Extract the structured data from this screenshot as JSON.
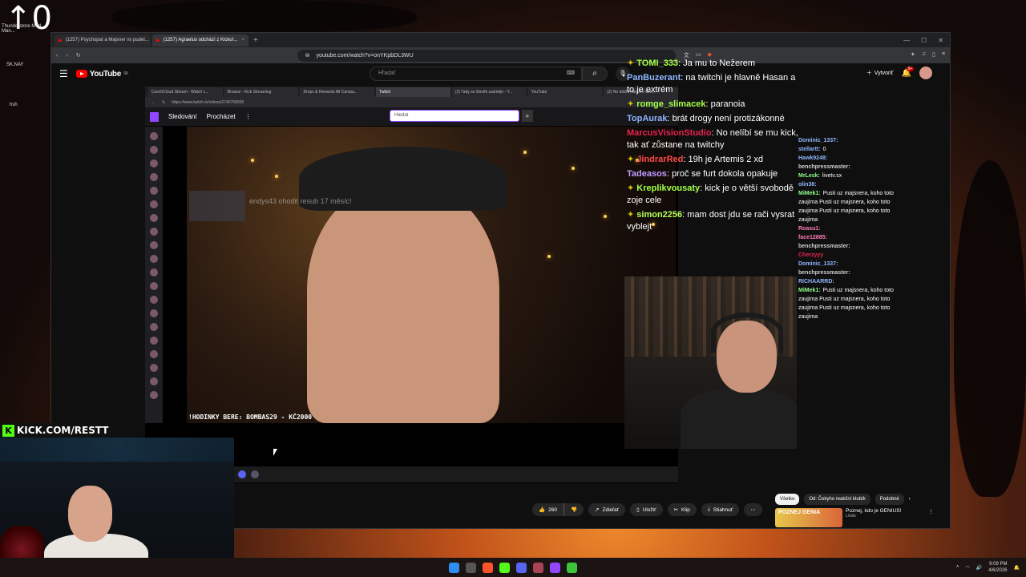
{
  "desktop": {
    "top_digit": "0",
    "labels": [
      "Thunderstore Mod Man...",
      "SK.NAY",
      "hsh"
    ]
  },
  "browser": {
    "tabs": [
      {
        "label": "(1257) Psychopat a Majsner vs pudel...",
        "active": false
      },
      {
        "label": "(1257) Agraelus odchází z Kicku!...",
        "active": true
      }
    ],
    "url": "youtube.com/watch?v=onYKpbDL3WU"
  },
  "youtube": {
    "logo_text": "YouTube",
    "region": "SK",
    "search_placeholder": "Hľadať",
    "create_label": "Vytvoriť",
    "notif_count": "9+"
  },
  "inner_browser": {
    "tabs": [
      "CzechCloud Stream - Watch L...",
      "Browse - Kick Streaming",
      "Drops & Rewards All Campa...",
      "Twitch",
      "(2) Tady se člověk zasměje - Y...",
      "YouTube",
      "(2) No dobře, tak si o tom..."
    ],
    "active_tab": 3,
    "url": "https://www.twitch.tv/videos/2740758965"
  },
  "twitch": {
    "nav_following": "Sledování",
    "nav_browse": "Procházet",
    "search_placeholder": "Hledat",
    "resub_text": "endys43 ohodit resub 17 měsíc!",
    "overlay_text": "!HODINKY BERE: BOMBAS29 - KČ2000"
  },
  "main_chat": [
    {
      "user": "TOMI_333",
      "color": "#a4ff46",
      "text": "Ja mu to Nežerem",
      "badge": true
    },
    {
      "user": "PanBuzerant",
      "color": "#8fb6ff",
      "text": "na twitchi je hlavně Hasan a to je extrém",
      "badge": false
    },
    {
      "user": "romge_slimacek",
      "color": "#a4ff46",
      "text": "paranoia",
      "badge": true
    },
    {
      "user": "TopAurak",
      "color": "#8fb6ff",
      "text": "brát drogy není protizákonné",
      "badge": false
    },
    {
      "user": "MarcusVisionStudio",
      "color": "#e8234f",
      "text": "No nelíbí se mu kick, tak ať zůstane na twitchy",
      "badge": false
    },
    {
      "user": "JindrarRed",
      "color": "#ff4a4a",
      "text": "19h je Artemis 2 xd",
      "badge": true
    },
    {
      "user": "Tadeasos",
      "color": "#c49bff",
      "text": "proč se furt dokola opakuje",
      "badge": false
    },
    {
      "user": "Kreplikvousaty",
      "color": "#a4ff46",
      "text": "kick je o větší svobodě zoje cele",
      "badge": true
    },
    {
      "user": "simon2256",
      "color": "#b8ff5a",
      "text": "mam dost jdu se rači vysrat vyblejt",
      "badge": true
    }
  ],
  "side_chat": [
    {
      "user": "Dominic_1337:",
      "color": "#8fb6ff",
      "text": ""
    },
    {
      "user": "stellartt:",
      "color": "#8fb6ff",
      "text": "0"
    },
    {
      "user": "Hawk9248:",
      "color": "#8fb6ff",
      "text": ""
    },
    {
      "user": "benchpressmaster:",
      "color": "#cfcfcf",
      "text": ""
    },
    {
      "user": "MrLesk:",
      "color": "#8fff8f",
      "text": "livetv.sx"
    },
    {
      "user": "olin38:",
      "color": "#8fb6ff",
      "text": ""
    },
    {
      "user": "MiMek1:",
      "color": "#8fff8f",
      "text": "Pusti uz majsnera, koho toto zaujima Pusti uz majsnera, koho toto zaujima Pusti uz majsnera, koho toto zaujima"
    },
    {
      "user": "Roasu1:",
      "color": "#ff7ab8",
      "text": ""
    },
    {
      "user": "face12885:",
      "color": "#ff7ab8",
      "text": ""
    },
    {
      "user": "benchpressmaster:",
      "color": "#cfcfcf",
      "text": ""
    },
    {
      "user": "Cherzyyy",
      "color": "#e8234f",
      "text": ""
    },
    {
      "user": "Dominic_1337:",
      "color": "#8fb6ff",
      "text": ""
    },
    {
      "user": "benchpressmaster:",
      "color": "#cfcfcf",
      "text": ""
    },
    {
      "user": "RICHAARRD:",
      "color": "#8fb6ff",
      "text": ""
    },
    {
      "user": "MiMek1:",
      "color": "#8fff8f",
      "text": "Pusti uz majsnera, koho toto zaujima Pusti uz majsnera, koho toto zaujima Pusti uz majsnera, koho toto zaujima"
    }
  ],
  "actions": {
    "like_count": "260",
    "share": "Zdieľať",
    "save": "Uložiť",
    "clip": "Klip",
    "download": "Stiahnuť"
  },
  "chips": [
    "Všetko",
    "Od: Čekyho reakční klubík",
    "Podobné"
  ],
  "recommendation": {
    "thumb_text": "POZNEJ GENIA",
    "title": "Poznej, kdo je GENIUS!",
    "channel": "Lišák"
  },
  "kick": {
    "banner": "KICK.COM/RESTT"
  },
  "tray": {
    "time": "9:09 PM",
    "date": "4/6/2026"
  },
  "colors": {
    "youtube_red": "#ff0000",
    "twitch_purple": "#9146ff",
    "kick_green": "#53fc18"
  }
}
